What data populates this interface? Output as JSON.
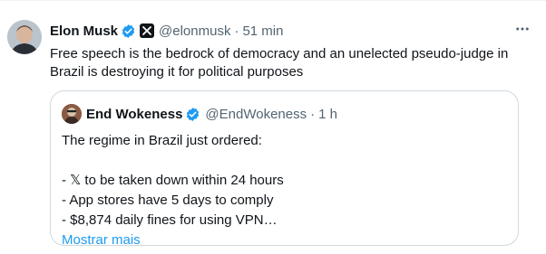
{
  "tweet": {
    "author_name": "Elon Musk",
    "author_handle": "@elonmusk",
    "separator": "·",
    "time": "51 min",
    "text": "Free speech is the bedrock of democracy and an unelected pseudo-judge in Brazil is destroying it for political purposes",
    "colors": {
      "verified": "#1d9bf0",
      "secondary_text": "#536471",
      "link": "#1d9bf0"
    }
  },
  "quote": {
    "author_name": "End Wokeness",
    "author_handle": "@EndWokeness",
    "separator": "·",
    "time": "1 h",
    "lines": [
      "The regime in Brazil just ordered:",
      "",
      "- 𝕏 to be taken down within 24 hours",
      "- App stores have 5 days to comply",
      "- $8,874 daily fines for using VPN…"
    ],
    "show_more": "Mostrar mais"
  }
}
